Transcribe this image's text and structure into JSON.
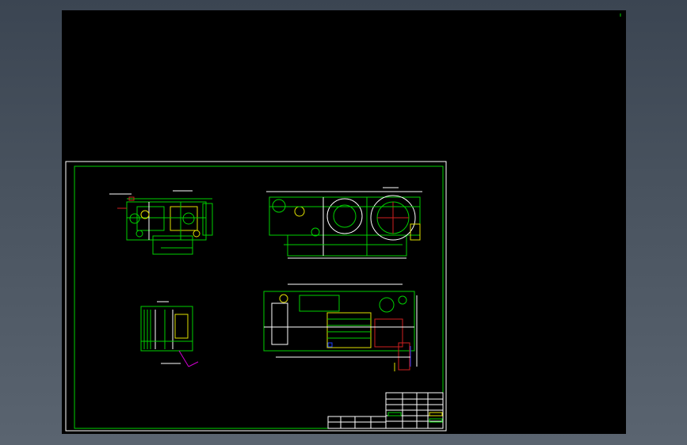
{
  "viewport": {
    "background": "#000000",
    "frame_color": "#ffffff",
    "border_color": "#00d000"
  },
  "drawings": [
    {
      "name": "top-left-view"
    },
    {
      "name": "top-right-view"
    },
    {
      "name": "bottom-left-section"
    },
    {
      "name": "bottom-right-section"
    }
  ],
  "title_block": {
    "present": true
  }
}
